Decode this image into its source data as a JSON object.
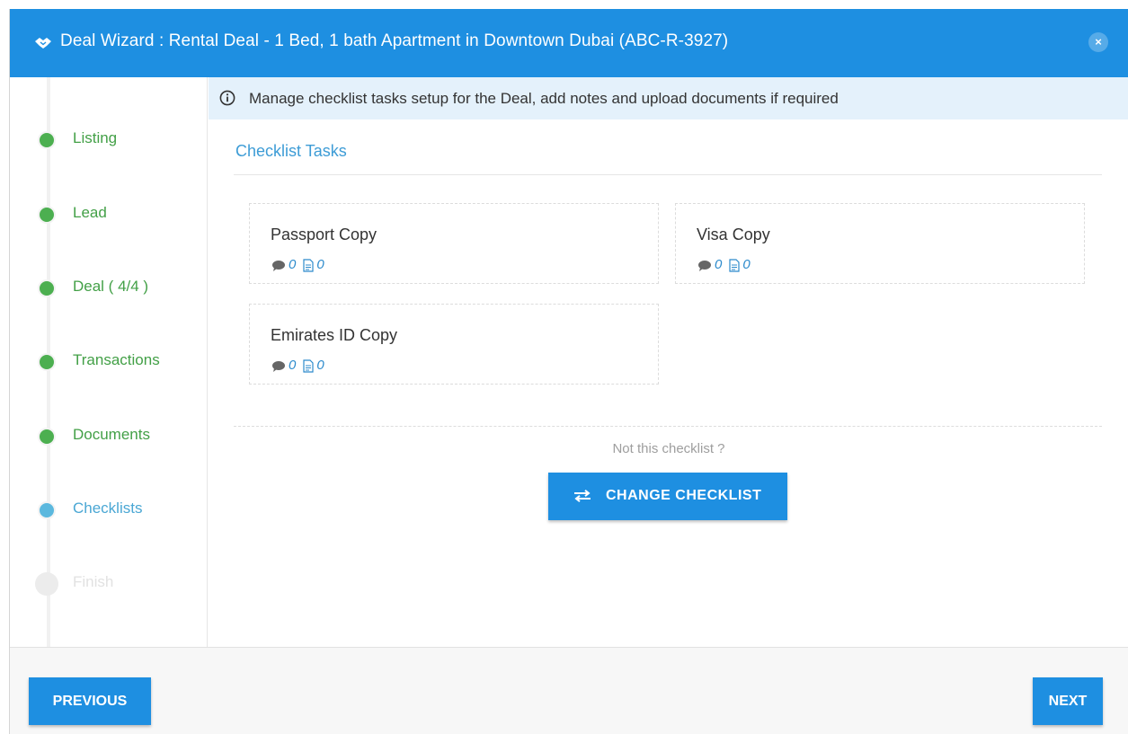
{
  "window": {
    "title": "Deal Wizard : Rental Deal - 1 Bed, 1 bath Apartment in Downtown Dubai (ABC-R-3927)",
    "title_icon": "handshake-icon",
    "close_label": "×"
  },
  "colors": {
    "primary": "#1e8fe1",
    "step_done": "#4caf50",
    "step_done_text": "#43a047",
    "step_active": "#5bb8de",
    "info_bg": "#e4f1fb",
    "section_title": "#3d9cd6"
  },
  "steps": [
    {
      "label": "Listing",
      "state": "done"
    },
    {
      "label": "Lead",
      "state": "done"
    },
    {
      "label": "Deal ( 4/4 )",
      "state": "done"
    },
    {
      "label": "Transactions",
      "state": "done"
    },
    {
      "label": "Documents",
      "state": "done"
    },
    {
      "label": "Checklists",
      "state": "active"
    },
    {
      "label": "Finish",
      "state": "pending"
    }
  ],
  "info": {
    "icon": "info-circle-icon",
    "text": "Manage checklist tasks setup for the Deal, add notes and upload documents if required"
  },
  "checklist": {
    "title": "Checklist Tasks",
    "tasks": [
      {
        "name": "Passport Copy",
        "comments": "0",
        "documents": "0"
      },
      {
        "name": "Visa Copy",
        "comments": "0",
        "documents": "0"
      },
      {
        "name": "Emirates ID Copy",
        "comments": "0",
        "documents": "0"
      }
    ],
    "not_this": "Not this checklist ?",
    "change_button": "CHANGE CHECKLIST",
    "change_icon": "exchange-icon"
  },
  "footer": {
    "previous": "PREVIOUS",
    "next": "NEXT"
  }
}
